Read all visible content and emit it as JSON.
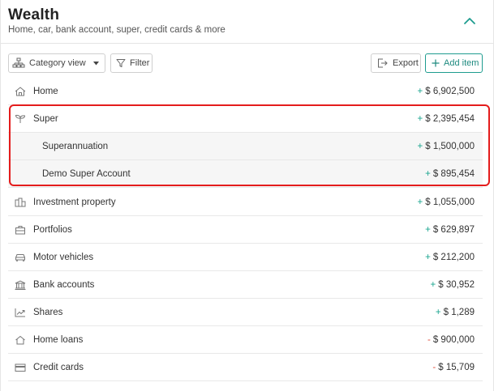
{
  "header": {
    "title": "Wealth",
    "subtitle": "Home, car, bank account, super, credit cards & more"
  },
  "toolbar": {
    "category_label": "Category view",
    "filter_label": "Filter",
    "export_label": "Export",
    "add_label": "Add item"
  },
  "items": [
    {
      "name": "Home",
      "sign": "+",
      "amount": "$ 6,902,500"
    },
    {
      "name": "Super",
      "sign": "+",
      "amount": "$ 2,395,454"
    },
    {
      "name": "Superannuation",
      "sign": "+",
      "amount": "$ 1,500,000"
    },
    {
      "name": "Demo Super Account",
      "sign": "+",
      "amount": "$ 895,454"
    },
    {
      "name": "Investment property",
      "sign": "+",
      "amount": "$ 1,055,000"
    },
    {
      "name": "Portfolios",
      "sign": "+",
      "amount": "$ 629,897"
    },
    {
      "name": "Motor vehicles",
      "sign": "+",
      "amount": "$ 212,200"
    },
    {
      "name": "Bank accounts",
      "sign": "+",
      "amount": "$ 30,952"
    },
    {
      "name": "Shares",
      "sign": "+",
      "amount": "$ 1,289"
    },
    {
      "name": "Home loans",
      "sign": "-",
      "amount": "$ 900,000"
    },
    {
      "name": "Credit cards",
      "sign": "-",
      "amount": "$ 15,709"
    }
  ],
  "colors": {
    "accent": "#1e9c8f",
    "positive": "#1aa58f",
    "negative": "#e0513f",
    "highlight": "#e41c1c"
  }
}
